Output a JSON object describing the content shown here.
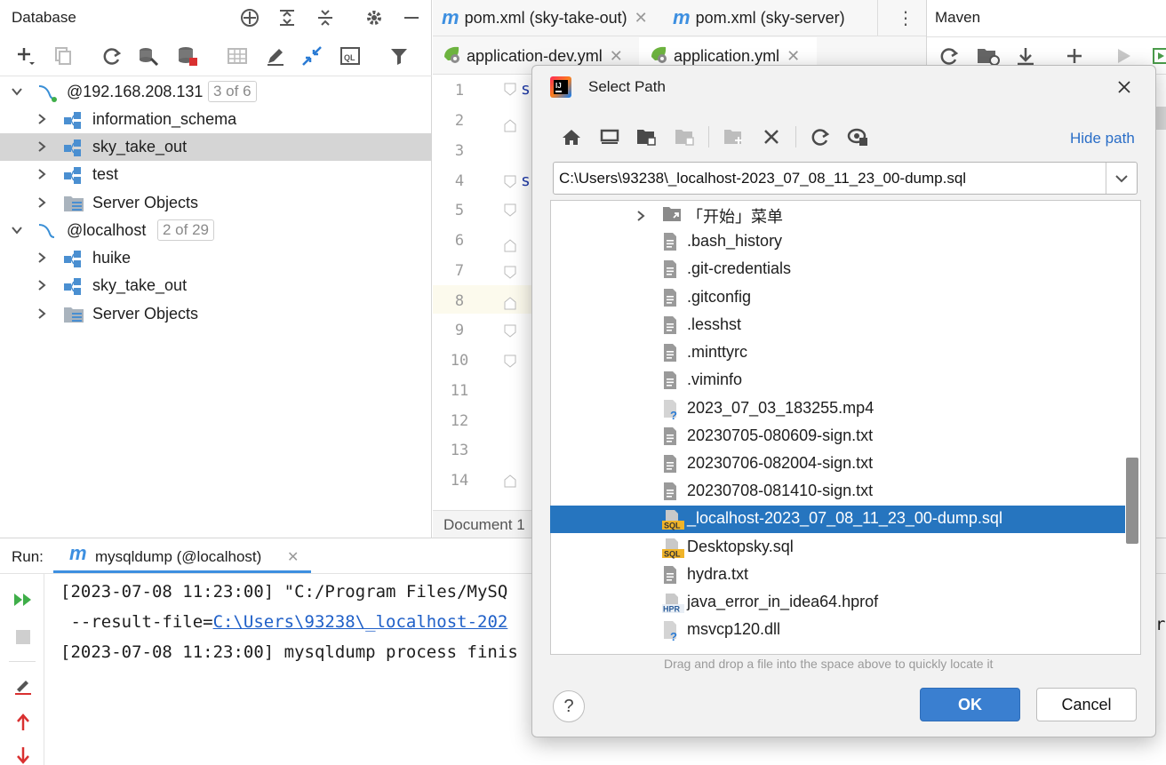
{
  "db_panel": {
    "title": "Database",
    "tree": [
      {
        "label": "@192.168.208.131",
        "badge": "3 of 6",
        "level": 0,
        "expanded": true,
        "icon": "mysql-connection-icon"
      },
      {
        "label": "information_schema",
        "level": 1,
        "icon": "schema-icon"
      },
      {
        "label": "sky_take_out",
        "level": 1,
        "icon": "schema-icon",
        "selected": true
      },
      {
        "label": "test",
        "level": 1,
        "icon": "schema-icon"
      },
      {
        "label": "Server Objects",
        "level": 1,
        "icon": "server-objects-icon"
      },
      {
        "label": "@localhost",
        "badge": "2 of 29",
        "level": 0,
        "expanded": true,
        "icon": "mysql-connection-icon"
      },
      {
        "label": "huike",
        "level": 1,
        "icon": "schema-icon"
      },
      {
        "label": "sky_take_out",
        "level": 1,
        "icon": "schema-icon"
      },
      {
        "label": "Server Objects",
        "level": 1,
        "icon": "server-objects-icon"
      }
    ]
  },
  "editor": {
    "tabs_row1": [
      {
        "label": "pom.xml (sky-take-out)"
      },
      {
        "label": "pom.xml (sky-server)"
      }
    ],
    "tabs_row2": [
      {
        "label": "application-dev.yml"
      },
      {
        "label": "application.yml"
      }
    ],
    "line_numbers": [
      "1",
      "2",
      "3",
      "4",
      "5",
      "6",
      "7",
      "8",
      "9",
      "10",
      "11",
      "12",
      "13",
      "14"
    ],
    "status": "Document 1"
  },
  "maven": {
    "title": "Maven"
  },
  "run": {
    "label": "Run:",
    "tab": "mysqldump (@localhost)",
    "lines": [
      "[2023-07-08 11:23:00] \"C:/Program Files/MySQ",
      " --result-file=",
      "[2023-07-08 11:23:00] mysqldump process finis"
    ],
    "link": "C:\\Users\\93238\\_localhost-202"
  },
  "dialog": {
    "title": "Select Path",
    "hide_path": "Hide path",
    "path_value": "C:\\Users\\93238\\_localhost-2023_07_08_11_23_00-dump.sql",
    "hint": "Drag and drop a file into the space above to quickly locate it",
    "ok": "OK",
    "cancel": "Cancel",
    "help": "?",
    "files": [
      {
        "name": "「开始」菜单",
        "icon": "folder-shortcut-icon",
        "folder": true
      },
      {
        "name": ".bash_history",
        "icon": "text-file-icon"
      },
      {
        "name": ".git-credentials",
        "icon": "text-file-icon"
      },
      {
        "name": ".gitconfig",
        "icon": "text-file-icon"
      },
      {
        "name": ".lesshst",
        "icon": "text-file-icon"
      },
      {
        "name": ".minttyrc",
        "icon": "text-file-icon"
      },
      {
        "name": ".viminfo",
        "icon": "text-file-icon"
      },
      {
        "name": "2023_07_03_183255.mp4",
        "icon": "unknown-file-icon"
      },
      {
        "name": "20230705-080609-sign.txt",
        "icon": "text-file-icon"
      },
      {
        "name": "20230706-082004-sign.txt",
        "icon": "text-file-icon"
      },
      {
        "name": "20230708-081410-sign.txt",
        "icon": "text-file-icon"
      },
      {
        "name": "_localhost-2023_07_08_11_23_00-dump.sql",
        "icon": "sql-file-icon",
        "selected": true
      },
      {
        "name": "Desktopsky.sql",
        "icon": "sql-file-icon"
      },
      {
        "name": "hydra.txt",
        "icon": "text-file-icon"
      },
      {
        "name": "java_error_in_idea64.hprof",
        "icon": "hprof-file-icon"
      },
      {
        "name": "msvcp120.dll",
        "icon": "unknown-file-icon"
      }
    ],
    "sql_tag": "SQL",
    "hpr_tag": "HPR"
  }
}
